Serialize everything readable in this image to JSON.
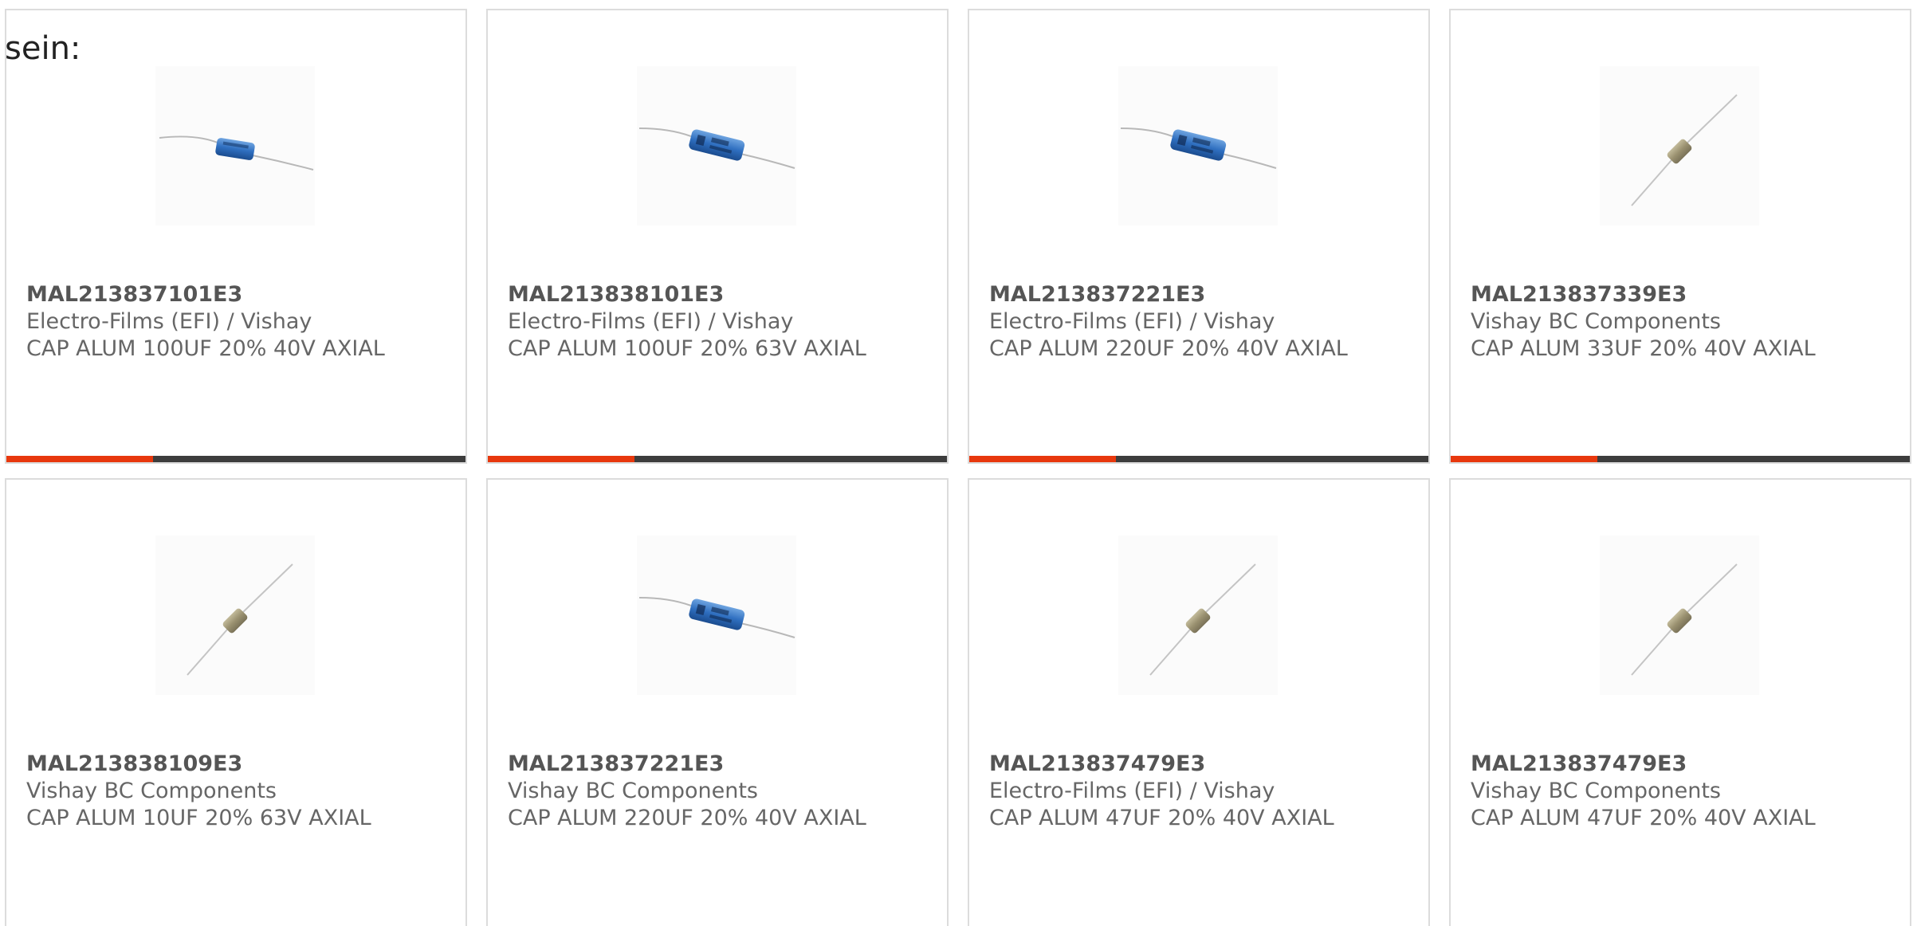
{
  "lead_text": "sein:",
  "colors": {
    "accent": "#e8380d",
    "track": "#3d3d3d",
    "border": "#dcdcdc",
    "text": "#666666"
  },
  "products": [
    {
      "part_number": "MAL213837101E3",
      "manufacturer": "Electro-Films (EFI) / Vishay",
      "description": "CAP ALUM 100UF 20% 40V AXIAL",
      "image_icon": "blue-capacitor-icon",
      "progress": 0.32
    },
    {
      "part_number": "MAL213838101E3",
      "manufacturer": "Electro-Films (EFI) / Vishay",
      "description": "CAP ALUM 100UF 20% 63V AXIAL",
      "image_icon": "blue-capacitor-icon",
      "progress": 0.32
    },
    {
      "part_number": "MAL213837221E3",
      "manufacturer": "Electro-Films (EFI) / Vishay",
      "description": "CAP ALUM 220UF 20% 40V AXIAL",
      "image_icon": "blue-capacitor-icon",
      "progress": 0.32
    },
    {
      "part_number": "MAL213837339E3",
      "manufacturer": "Vishay BC Components",
      "description": "CAP ALUM 33UF 20% 40V AXIAL",
      "image_icon": "beige-capacitor-icon",
      "progress": 0.32
    },
    {
      "part_number": "MAL213838109E3",
      "manufacturer": "Vishay BC Components",
      "description": "CAP ALUM 10UF 20% 63V AXIAL",
      "image_icon": "beige-capacitor-icon"
    },
    {
      "part_number": "MAL213837221E3",
      "manufacturer": "Vishay BC Components",
      "description": "CAP ALUM 220UF 20% 40V AXIAL",
      "image_icon": "blue-capacitor-icon"
    },
    {
      "part_number": "MAL213837479E3",
      "manufacturer": "Electro-Films (EFI) / Vishay",
      "description": "CAP ALUM 47UF 20% 40V AXIAL",
      "image_icon": "beige-capacitor-icon"
    },
    {
      "part_number": "MAL213837479E3",
      "manufacturer": "Vishay BC Components",
      "description": "CAP ALUM 47UF 20% 40V AXIAL",
      "image_icon": "beige-capacitor-icon"
    }
  ]
}
